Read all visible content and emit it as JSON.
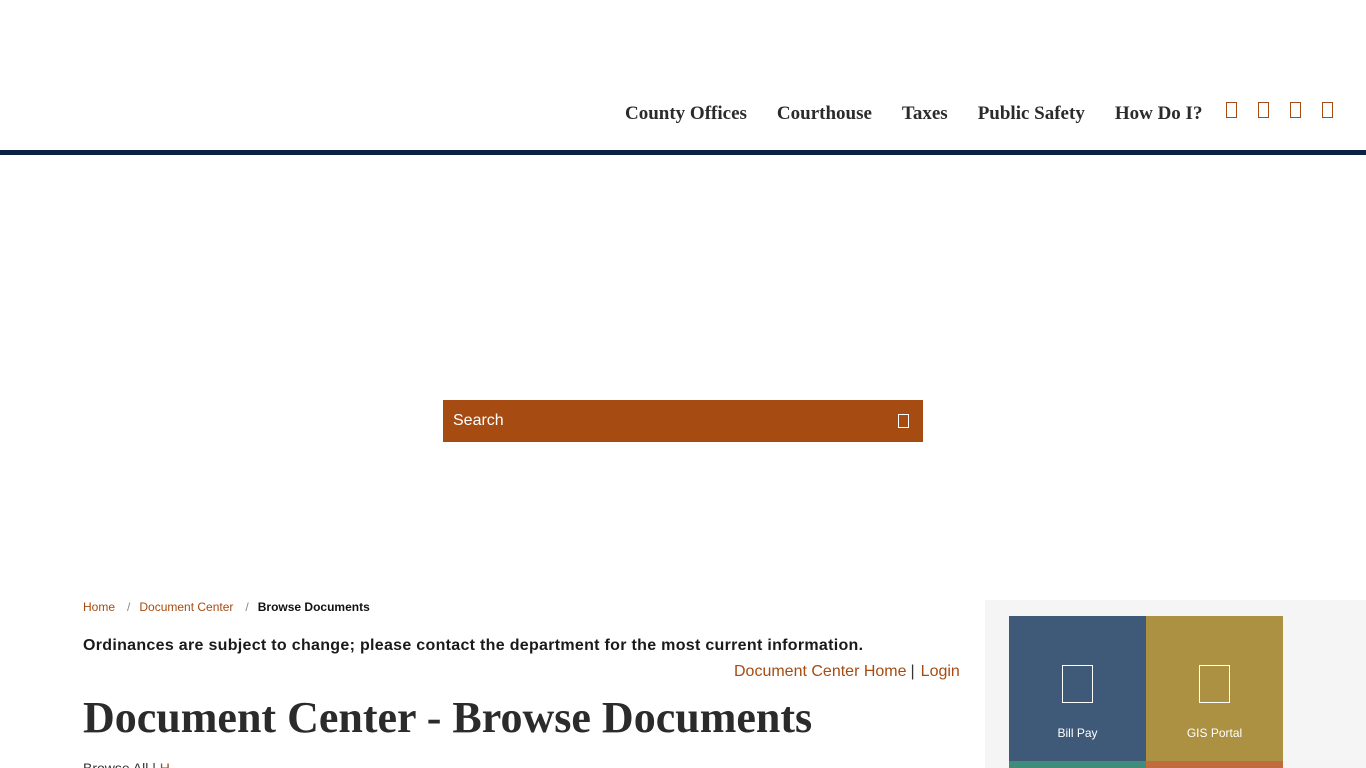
{
  "nav": {
    "items": [
      {
        "label": "County Offices"
      },
      {
        "label": "Courthouse"
      },
      {
        "label": "Taxes"
      },
      {
        "label": "Public Safety"
      },
      {
        "label": "How Do I?"
      }
    ],
    "icons": [
      "social-icon-1",
      "social-icon-2",
      "social-icon-3",
      "social-icon-4"
    ]
  },
  "search": {
    "placeholder": "Search"
  },
  "breadcrumb": {
    "home": "Home",
    "separator": "/",
    "document_center": "Document Center",
    "current": "Browse Documents"
  },
  "notice": "Ordinances are subject to change; please contact the department for the most current information.",
  "doc_links": {
    "home": "Document Center Home",
    "separator": "|",
    "login": "Login"
  },
  "page_title": "Document Center - Browse Documents",
  "sub_line": {
    "text": "Browse All |",
    "link": "Н"
  },
  "sidebar": {
    "tiles": [
      {
        "label": "Bill Pay",
        "icon": "bill-pay-icon"
      },
      {
        "label": "GIS Portal",
        "icon": "gis-portal-icon"
      }
    ]
  },
  "colors": {
    "accent": "#a64b11",
    "navy": "#0b2144",
    "tile_blue": "#3f5a78",
    "tile_gold": "#ab9141",
    "tile_green": "#3e8c79",
    "tile_orange": "#c1693f"
  }
}
